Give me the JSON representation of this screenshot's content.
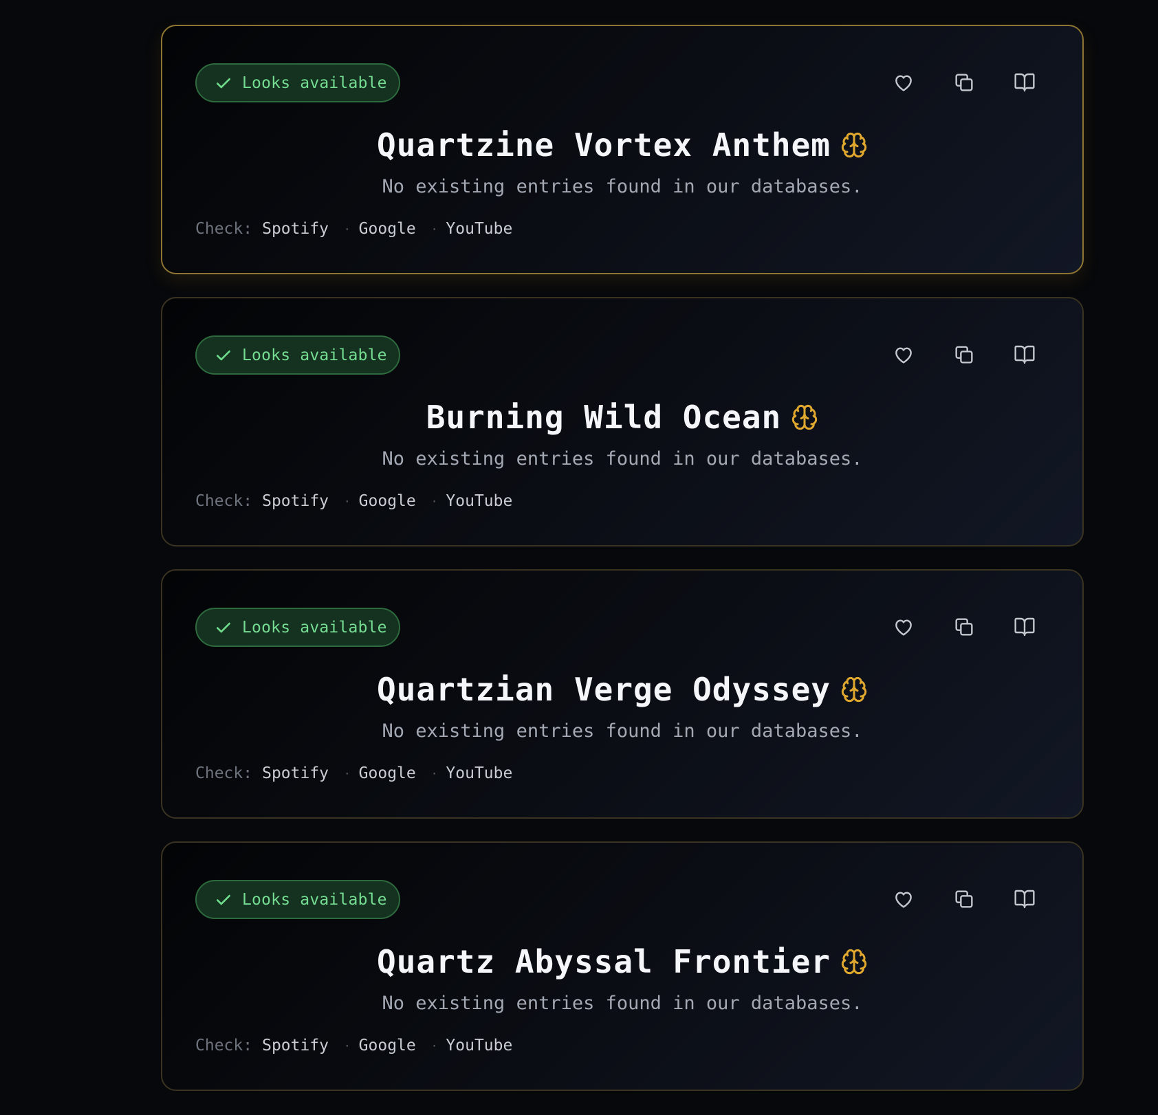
{
  "results": [
    {
      "status": "Looks available",
      "title": "Quartzine Vortex Anthem",
      "subtitle": "No existing entries found in our databases.",
      "check_label": "Check:",
      "links": [
        "Spotify",
        "Google",
        "YouTube"
      ],
      "selected": true
    },
    {
      "status": "Looks available",
      "title": "Burning Wild Ocean",
      "subtitle": "No existing entries found in our databases.",
      "check_label": "Check:",
      "links": [
        "Spotify",
        "Google",
        "YouTube"
      ],
      "selected": false
    },
    {
      "status": "Looks available",
      "title": "Quartzian Verge Odyssey",
      "subtitle": "No existing entries found in our databases.",
      "check_label": "Check:",
      "links": [
        "Spotify",
        "Google",
        "YouTube"
      ],
      "selected": false
    },
    {
      "status": "Looks available",
      "title": "Quartz Abyssal Frontier",
      "subtitle": "No existing entries found in our databases.",
      "check_label": "Check:",
      "links": [
        "Spotify",
        "Google",
        "YouTube"
      ],
      "selected": false
    }
  ],
  "icons": {
    "status": "check-icon",
    "title_badge": "brain-icon",
    "actions": [
      "heart-icon",
      "copy-icon",
      "book-icon"
    ]
  },
  "colors": {
    "background": "#07080b",
    "selected_border": "#8e7533",
    "card_border": "#3a3322",
    "status_green": "#74dd92",
    "status_bg": "#153120",
    "brain_gold": "#e0a82e"
  }
}
